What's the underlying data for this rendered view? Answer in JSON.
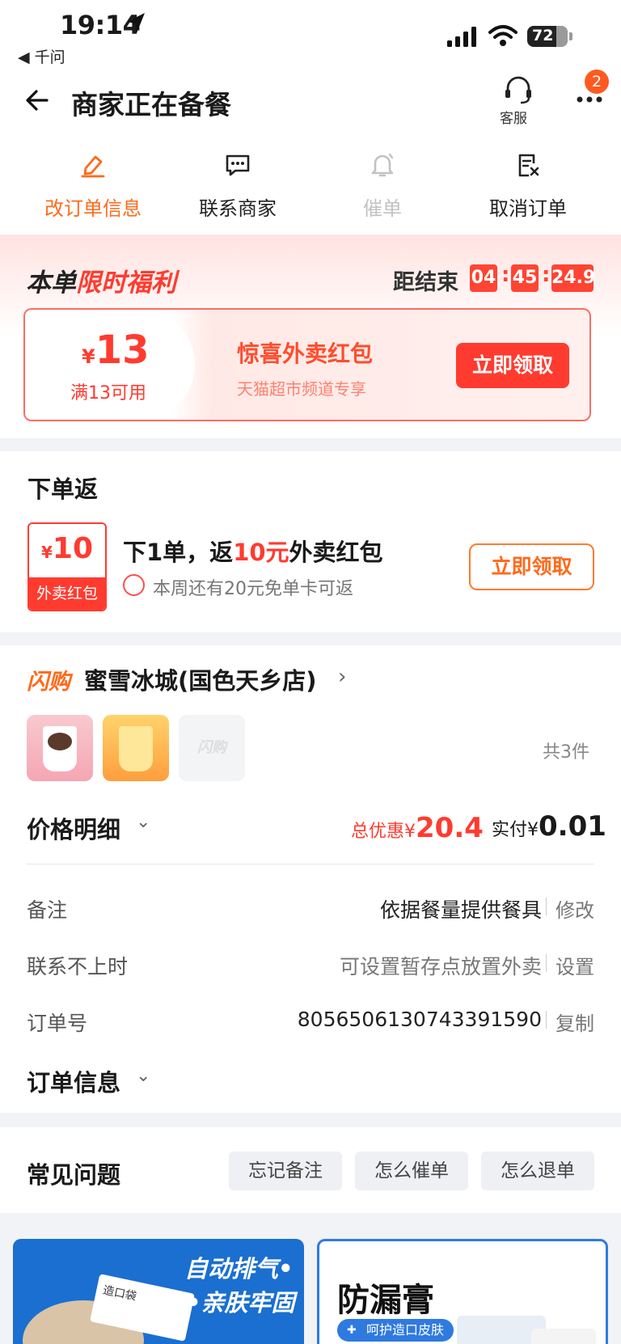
{
  "status_bar": {
    "time": "19:14",
    "back_app": "◀ 千问",
    "battery": "72"
  },
  "header": {
    "title": "商家正在备餐",
    "service_label": "客服",
    "more_badge": "2"
  },
  "actions": [
    {
      "label": "改订单信息",
      "icon": "edit-icon",
      "color": "#ff6a1a"
    },
    {
      "label": "联系商家",
      "icon": "chat-icon",
      "color": "#222222"
    },
    {
      "label": "催单",
      "icon": "bell-icon",
      "color": "#c2c2c2"
    },
    {
      "label": "取消订单",
      "icon": "cancel-order-icon",
      "color": "#222222"
    }
  ],
  "benefit": {
    "title_a": "本单",
    "title_b": "限时福利",
    "countdown_label": "距结束",
    "countdown": [
      "04",
      "45",
      "24.9"
    ],
    "coupon": {
      "currency": "¥",
      "amount": "13",
      "condition": "满13可用",
      "title": "惊喜外卖红包",
      "subtitle": "天猫超市频道专享",
      "button": "立即领取"
    }
  },
  "order_return": {
    "title": "下单返",
    "packet_currency": "¥",
    "packet_amount": "10",
    "packet_label": "外卖红包",
    "main_a": "下1单，返",
    "main_red": "10元",
    "main_b": "外卖红包",
    "sub": "本周还有20元免单卡可返",
    "button": "立即领取"
  },
  "store": {
    "brand": "闪购",
    "name": "蜜雪冰城(国色天乡店)",
    "thumb_ghost": "闪购",
    "item_count": "共3件",
    "price_label": "价格明细",
    "discount_label": "总优惠",
    "discount_currency": "¥",
    "discount_value": "20.4",
    "paid_label": "实付",
    "paid_currency": "¥",
    "paid_value": "0.01",
    "rows": [
      {
        "label": "备注",
        "value": "依据餐量提供餐具",
        "action": "修改"
      },
      {
        "label": "联系不上时",
        "value": "可设置暂存点放置外卖",
        "action": "设置"
      },
      {
        "label": "订单号",
        "value": "8056506130743391590",
        "action": "复制"
      }
    ],
    "info_label": "订单信息"
  },
  "faq": {
    "title": "常见问题",
    "chips": [
      "忘记备注",
      "怎么催单",
      "怎么退单"
    ]
  },
  "ads": {
    "ad1_line1": "自动排气•",
    "ad1_line2": "•亲肤牢固",
    "ad1_box": "造口袋",
    "ad2_title": "防漏膏",
    "ad2_pill": "呵护造口皮肤"
  }
}
